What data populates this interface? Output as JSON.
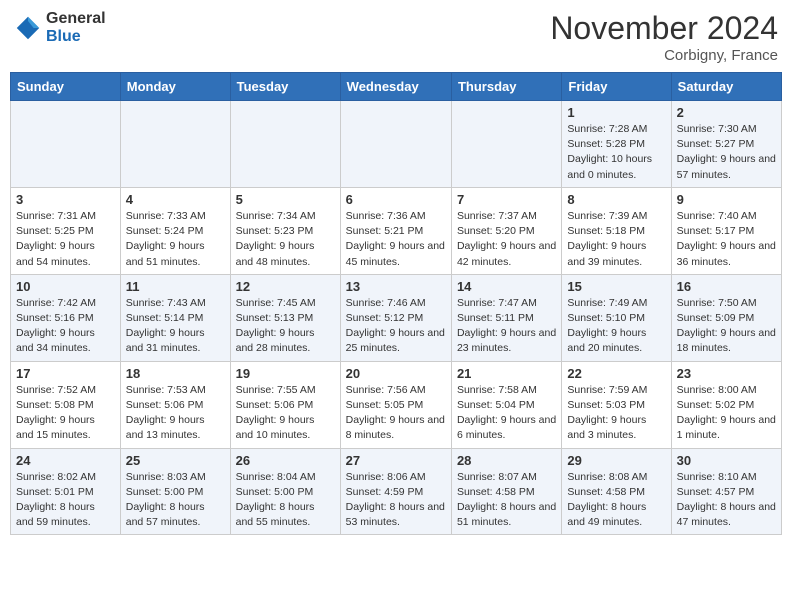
{
  "header": {
    "logo_general": "General",
    "logo_blue": "Blue",
    "month_title": "November 2024",
    "location": "Corbigny, France"
  },
  "days_of_week": [
    "Sunday",
    "Monday",
    "Tuesday",
    "Wednesday",
    "Thursday",
    "Friday",
    "Saturday"
  ],
  "weeks": [
    [
      {
        "day": "",
        "info": ""
      },
      {
        "day": "",
        "info": ""
      },
      {
        "day": "",
        "info": ""
      },
      {
        "day": "",
        "info": ""
      },
      {
        "day": "",
        "info": ""
      },
      {
        "day": "1",
        "info": "Sunrise: 7:28 AM\nSunset: 5:28 PM\nDaylight: 10 hours\nand 0 minutes."
      },
      {
        "day": "2",
        "info": "Sunrise: 7:30 AM\nSunset: 5:27 PM\nDaylight: 9 hours\nand 57 minutes."
      }
    ],
    [
      {
        "day": "3",
        "info": "Sunrise: 7:31 AM\nSunset: 5:25 PM\nDaylight: 9 hours\nand 54 minutes."
      },
      {
        "day": "4",
        "info": "Sunrise: 7:33 AM\nSunset: 5:24 PM\nDaylight: 9 hours\nand 51 minutes."
      },
      {
        "day": "5",
        "info": "Sunrise: 7:34 AM\nSunset: 5:23 PM\nDaylight: 9 hours\nand 48 minutes."
      },
      {
        "day": "6",
        "info": "Sunrise: 7:36 AM\nSunset: 5:21 PM\nDaylight: 9 hours\nand 45 minutes."
      },
      {
        "day": "7",
        "info": "Sunrise: 7:37 AM\nSunset: 5:20 PM\nDaylight: 9 hours\nand 42 minutes."
      },
      {
        "day": "8",
        "info": "Sunrise: 7:39 AM\nSunset: 5:18 PM\nDaylight: 9 hours\nand 39 minutes."
      },
      {
        "day": "9",
        "info": "Sunrise: 7:40 AM\nSunset: 5:17 PM\nDaylight: 9 hours\nand 36 minutes."
      }
    ],
    [
      {
        "day": "10",
        "info": "Sunrise: 7:42 AM\nSunset: 5:16 PM\nDaylight: 9 hours\nand 34 minutes."
      },
      {
        "day": "11",
        "info": "Sunrise: 7:43 AM\nSunset: 5:14 PM\nDaylight: 9 hours\nand 31 minutes."
      },
      {
        "day": "12",
        "info": "Sunrise: 7:45 AM\nSunset: 5:13 PM\nDaylight: 9 hours\nand 28 minutes."
      },
      {
        "day": "13",
        "info": "Sunrise: 7:46 AM\nSunset: 5:12 PM\nDaylight: 9 hours\nand 25 minutes."
      },
      {
        "day": "14",
        "info": "Sunrise: 7:47 AM\nSunset: 5:11 PM\nDaylight: 9 hours\nand 23 minutes."
      },
      {
        "day": "15",
        "info": "Sunrise: 7:49 AM\nSunset: 5:10 PM\nDaylight: 9 hours\nand 20 minutes."
      },
      {
        "day": "16",
        "info": "Sunrise: 7:50 AM\nSunset: 5:09 PM\nDaylight: 9 hours\nand 18 minutes."
      }
    ],
    [
      {
        "day": "17",
        "info": "Sunrise: 7:52 AM\nSunset: 5:08 PM\nDaylight: 9 hours\nand 15 minutes."
      },
      {
        "day": "18",
        "info": "Sunrise: 7:53 AM\nSunset: 5:06 PM\nDaylight: 9 hours\nand 13 minutes."
      },
      {
        "day": "19",
        "info": "Sunrise: 7:55 AM\nSunset: 5:06 PM\nDaylight: 9 hours\nand 10 minutes."
      },
      {
        "day": "20",
        "info": "Sunrise: 7:56 AM\nSunset: 5:05 PM\nDaylight: 9 hours\nand 8 minutes."
      },
      {
        "day": "21",
        "info": "Sunrise: 7:58 AM\nSunset: 5:04 PM\nDaylight: 9 hours\nand 6 minutes."
      },
      {
        "day": "22",
        "info": "Sunrise: 7:59 AM\nSunset: 5:03 PM\nDaylight: 9 hours\nand 3 minutes."
      },
      {
        "day": "23",
        "info": "Sunrise: 8:00 AM\nSunset: 5:02 PM\nDaylight: 9 hours\nand 1 minute."
      }
    ],
    [
      {
        "day": "24",
        "info": "Sunrise: 8:02 AM\nSunset: 5:01 PM\nDaylight: 8 hours\nand 59 minutes."
      },
      {
        "day": "25",
        "info": "Sunrise: 8:03 AM\nSunset: 5:00 PM\nDaylight: 8 hours\nand 57 minutes."
      },
      {
        "day": "26",
        "info": "Sunrise: 8:04 AM\nSunset: 5:00 PM\nDaylight: 8 hours\nand 55 minutes."
      },
      {
        "day": "27",
        "info": "Sunrise: 8:06 AM\nSunset: 4:59 PM\nDaylight: 8 hours\nand 53 minutes."
      },
      {
        "day": "28",
        "info": "Sunrise: 8:07 AM\nSunset: 4:58 PM\nDaylight: 8 hours\nand 51 minutes."
      },
      {
        "day": "29",
        "info": "Sunrise: 8:08 AM\nSunset: 4:58 PM\nDaylight: 8 hours\nand 49 minutes."
      },
      {
        "day": "30",
        "info": "Sunrise: 8:10 AM\nSunset: 4:57 PM\nDaylight: 8 hours\nand 47 minutes."
      }
    ]
  ]
}
